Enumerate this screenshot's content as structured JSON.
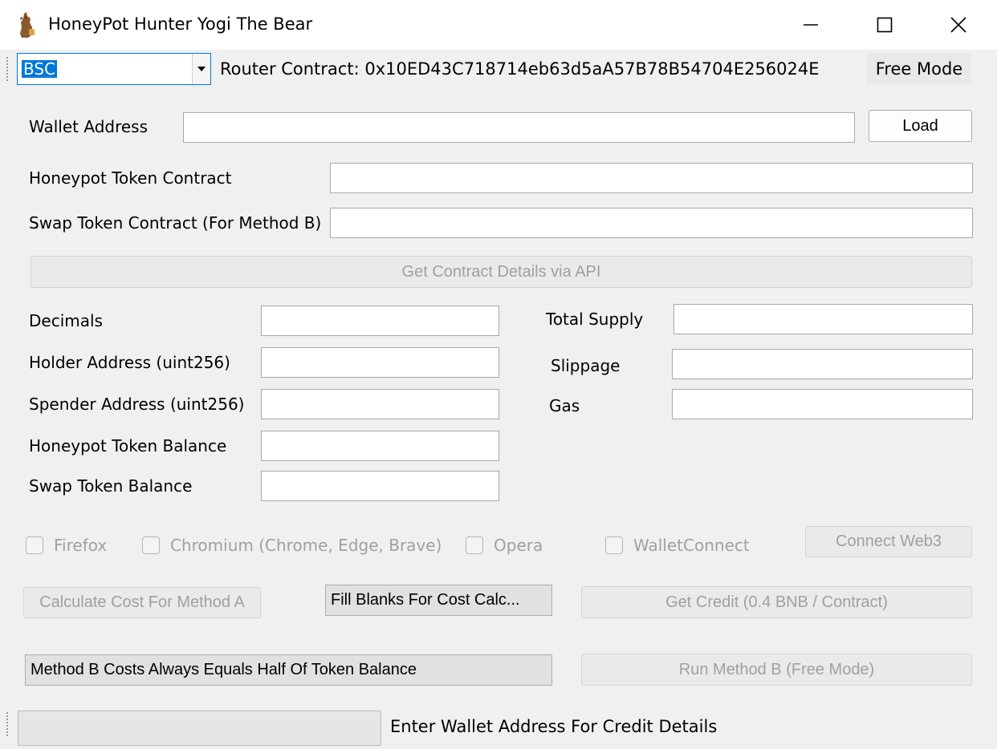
{
  "window": {
    "title": "HoneyPot Hunter Yogi The Bear"
  },
  "toolbar": {
    "network_selected": "BSC",
    "router_label": "Router Contract: 0x10ED43C718714eb63d5aA57B78B54704E256024E",
    "mode_label": "Free Mode"
  },
  "form": {
    "wallet_label": "Wallet Address",
    "wallet_value": "",
    "load_button": "Load",
    "honeypot_contract_label": "Honeypot Token Contract",
    "honeypot_contract_value": "",
    "swap_contract_label": "Swap Token Contract (For Method B)",
    "swap_contract_value": "",
    "get_details_button": "Get Contract Details via API",
    "decimals_label": "Decimals",
    "holder_label": "Holder Address (uint256)",
    "spender_label": "Spender Address (uint256)",
    "honeypot_balance_label": "Honeypot Token Balance",
    "swap_balance_label": "Swap Token Balance",
    "total_supply_label": "Total Supply",
    "slippage_label": "Slippage",
    "gas_label": "Gas"
  },
  "browsers": {
    "firefox": "Firefox",
    "chromium": "Chromium (Chrome, Edge, Brave)",
    "opera": "Opera",
    "walletconnect": "WalletConnect",
    "connect_button": "Connect Web3"
  },
  "actions": {
    "calc_a": "Calculate Cost For Method A",
    "fill_blanks": "Fill Blanks For Cost Calc...",
    "get_credit": "Get Credit (0.4 BNB / Contract)",
    "method_b_info": "Method B Costs Always Equals Half Of Token Balance",
    "run_b": "Run Method B (Free Mode)"
  },
  "status": {
    "progress": 0,
    "text": "Enter Wallet Address For Credit Details"
  },
  "colors": {
    "accent": "#0078d7",
    "window_bg": "#f0f0f0",
    "disabled_text": "#a0a0a0",
    "progress_fill": "#06b025"
  },
  "icons": [
    "bear-app-icon",
    "minimize-icon",
    "maximize-icon",
    "close-icon",
    "dropdown-arrow-icon",
    "grip-icon"
  ]
}
